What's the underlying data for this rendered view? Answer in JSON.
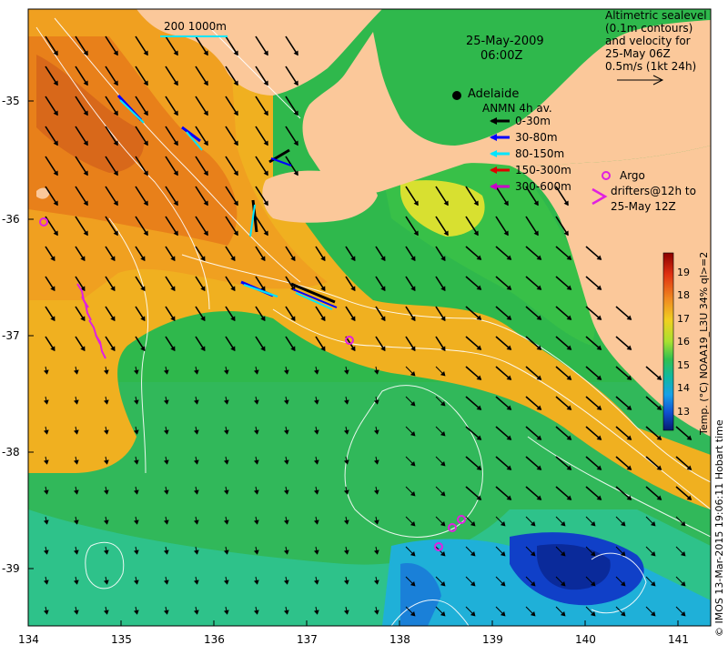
{
  "map": {
    "date": "25-May-2009",
    "time": "06:00Z",
    "city": "Adelaide",
    "scale_label": "200  1000m",
    "altimetry_note": [
      "Altimetric sealevel",
      "(0.1m contours)",
      "and velocity for",
      "25-May 06Z",
      "0.5m/s (1kt 24h)"
    ],
    "anmn_title": "ANMN 4h av.",
    "depth_legend": [
      {
        "label": "0-30m",
        "color": "#000000"
      },
      {
        "label": "30-80m",
        "color": "#0000ff"
      },
      {
        "label": "80-150m",
        "color": "#00e5ff"
      },
      {
        "label": "150-300m",
        "color": "#e00000"
      },
      {
        "label": "300-600m",
        "color": "#c800c8"
      }
    ],
    "argo_legend": [
      "Argo",
      "drifters@12h to",
      "25-May 12Z"
    ],
    "colorbar_title": "Temp. (°C) NOAA19_L3U 34% ql>=2",
    "colorbar_ticks": [
      "19",
      "18",
      "17",
      "16",
      "15",
      "14",
      "13"
    ],
    "credit": "© IMOS 13-Mar-2015 19:06:11 Hobart time",
    "x_ticks": [
      "134",
      "135",
      "136",
      "137",
      "138",
      "139",
      "140",
      "141"
    ],
    "y_ticks": [
      "-35",
      "-36",
      "-37",
      "-38",
      "-39"
    ],
    "colors": {
      "land": "#fbc89a",
      "argo": "#e020e0",
      "cool": "#0a2a9a",
      "warm": "#e0801a"
    }
  }
}
